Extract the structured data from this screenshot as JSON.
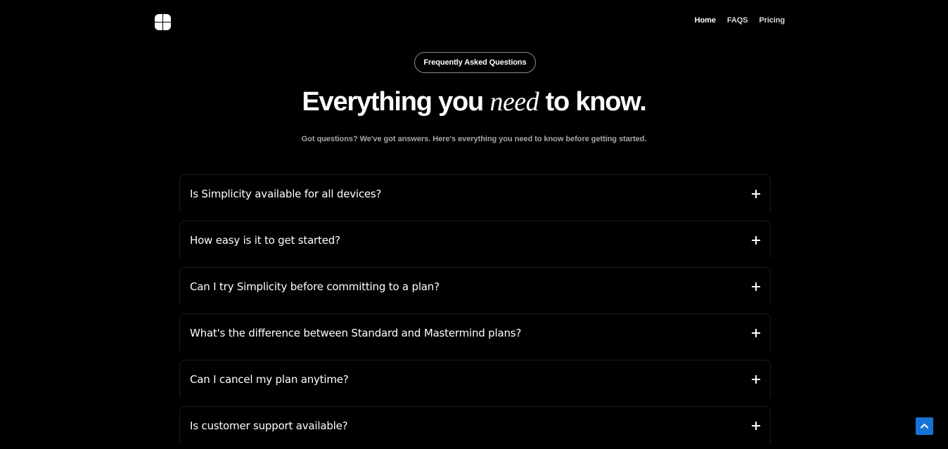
{
  "header": {
    "logo_icon": "four-petal-grid-logo",
    "nav": [
      {
        "label": "Home",
        "active": true
      },
      {
        "label": "FAQS",
        "active": false
      },
      {
        "label": "Pricing",
        "active": false
      }
    ]
  },
  "hero": {
    "badge": "Frequently Asked Questions",
    "headline_before": "Everything you ",
    "headline_accent": "need",
    "headline_after": " to know.",
    "subtitle": "Got questions? We've got answers. Here's everything you need to know before getting started."
  },
  "faq": {
    "items": [
      {
        "question": "Is Simplicity available for all devices?",
        "icon": "plus-icon"
      },
      {
        "question": "How easy is it to get started?",
        "icon": "plus-icon"
      },
      {
        "question": "Can I try Simplicity before committing to a plan?",
        "icon": "plus-icon"
      },
      {
        "question": "What's the difference between Standard and Mastermind plans?",
        "icon": "plus-icon"
      },
      {
        "question": "Can I cancel my plan anytime?",
        "icon": "plus-icon"
      },
      {
        "question": "Is customer support available?",
        "icon": "plus-icon"
      }
    ]
  },
  "back_to_top": {
    "icon": "chevron-up-icon",
    "color": "#1673d6"
  }
}
